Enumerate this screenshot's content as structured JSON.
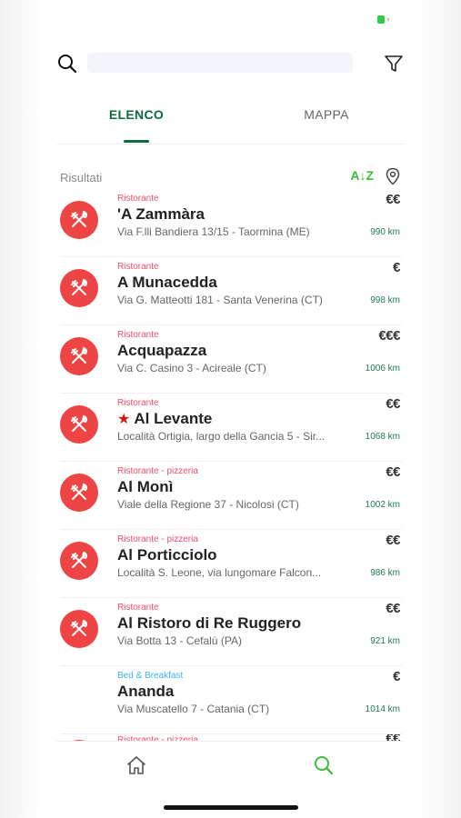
{
  "search": {
    "placeholder": ""
  },
  "tabs": [
    {
      "label": "ELENCO",
      "active": true
    },
    {
      "label": "MAPPA",
      "active": false
    }
  ],
  "results": {
    "label": "Risultati",
    "sort_label": "A↓Z"
  },
  "colors": {
    "accent_green": "#0b6b3f",
    "sort_green": "#3dbb3d",
    "avatar_red": "#ef4444",
    "category_pink": "#ef4f6a",
    "category_blue": "#40b4e6",
    "star_red": "#d81515"
  },
  "items": [
    {
      "category": "Ristorante",
      "name": "'A Zammàra",
      "address": "Via F.lli Bandiera 13/15 - Taormina (ME)",
      "price": "€€",
      "distance": "990 km",
      "icon": "fork-knife-icon",
      "starred": false
    },
    {
      "category": "Ristorante",
      "name": "A Munacedda",
      "address": "Via G. Matteotti 181 - Santa Venerina (CT)",
      "price": "€",
      "distance": "998 km",
      "icon": "fork-knife-icon",
      "starred": false
    },
    {
      "category": "Ristorante",
      "name": "Acquapazza",
      "address": "Via C. Casino 3 - Acireale (CT)",
      "price": "€€€",
      "distance": "1006 km",
      "icon": "fork-knife-icon",
      "starred": false
    },
    {
      "category": "Ristorante",
      "name": "Al Levante",
      "address": "Località Ortigia, largo della Gancia 5 - Sir...",
      "price": "€€",
      "distance": "1068 km",
      "icon": "fork-knife-icon",
      "starred": true
    },
    {
      "category": "Ristorante - pizzeria",
      "name": "Al Monì",
      "address": "Viale della Regione 37 - Nicolosi (CT)",
      "price": "€€",
      "distance": "1002 km",
      "icon": "fork-knife-icon",
      "starred": false
    },
    {
      "category": "Ristorante - pizzeria",
      "name": "Al Porticciolo",
      "address": "Località S. Leone, via lungomare Falcon...",
      "price": "€€",
      "distance": "986 km",
      "icon": "fork-knife-icon",
      "starred": false
    },
    {
      "category": "Ristorante",
      "name": "Al Ristoro di Re Ruggero",
      "address": "Via Botta 13 - Cefalù (PA)",
      "price": "€€",
      "distance": "921 km",
      "icon": "fork-knife-icon",
      "starred": false
    },
    {
      "category": "Bed & Breakfast",
      "name": "Ananda",
      "address": "Via Muscatello 7 - Catania (CT)",
      "price": "€",
      "distance": "1014 km",
      "icon": "",
      "starred": false
    }
  ],
  "partial_item": {
    "category": "Ristorante - pizzeria",
    "price": "€€"
  },
  "bottom_nav": [
    {
      "icon": "home-icon",
      "active": false
    },
    {
      "icon": "search-icon",
      "active": true
    }
  ]
}
